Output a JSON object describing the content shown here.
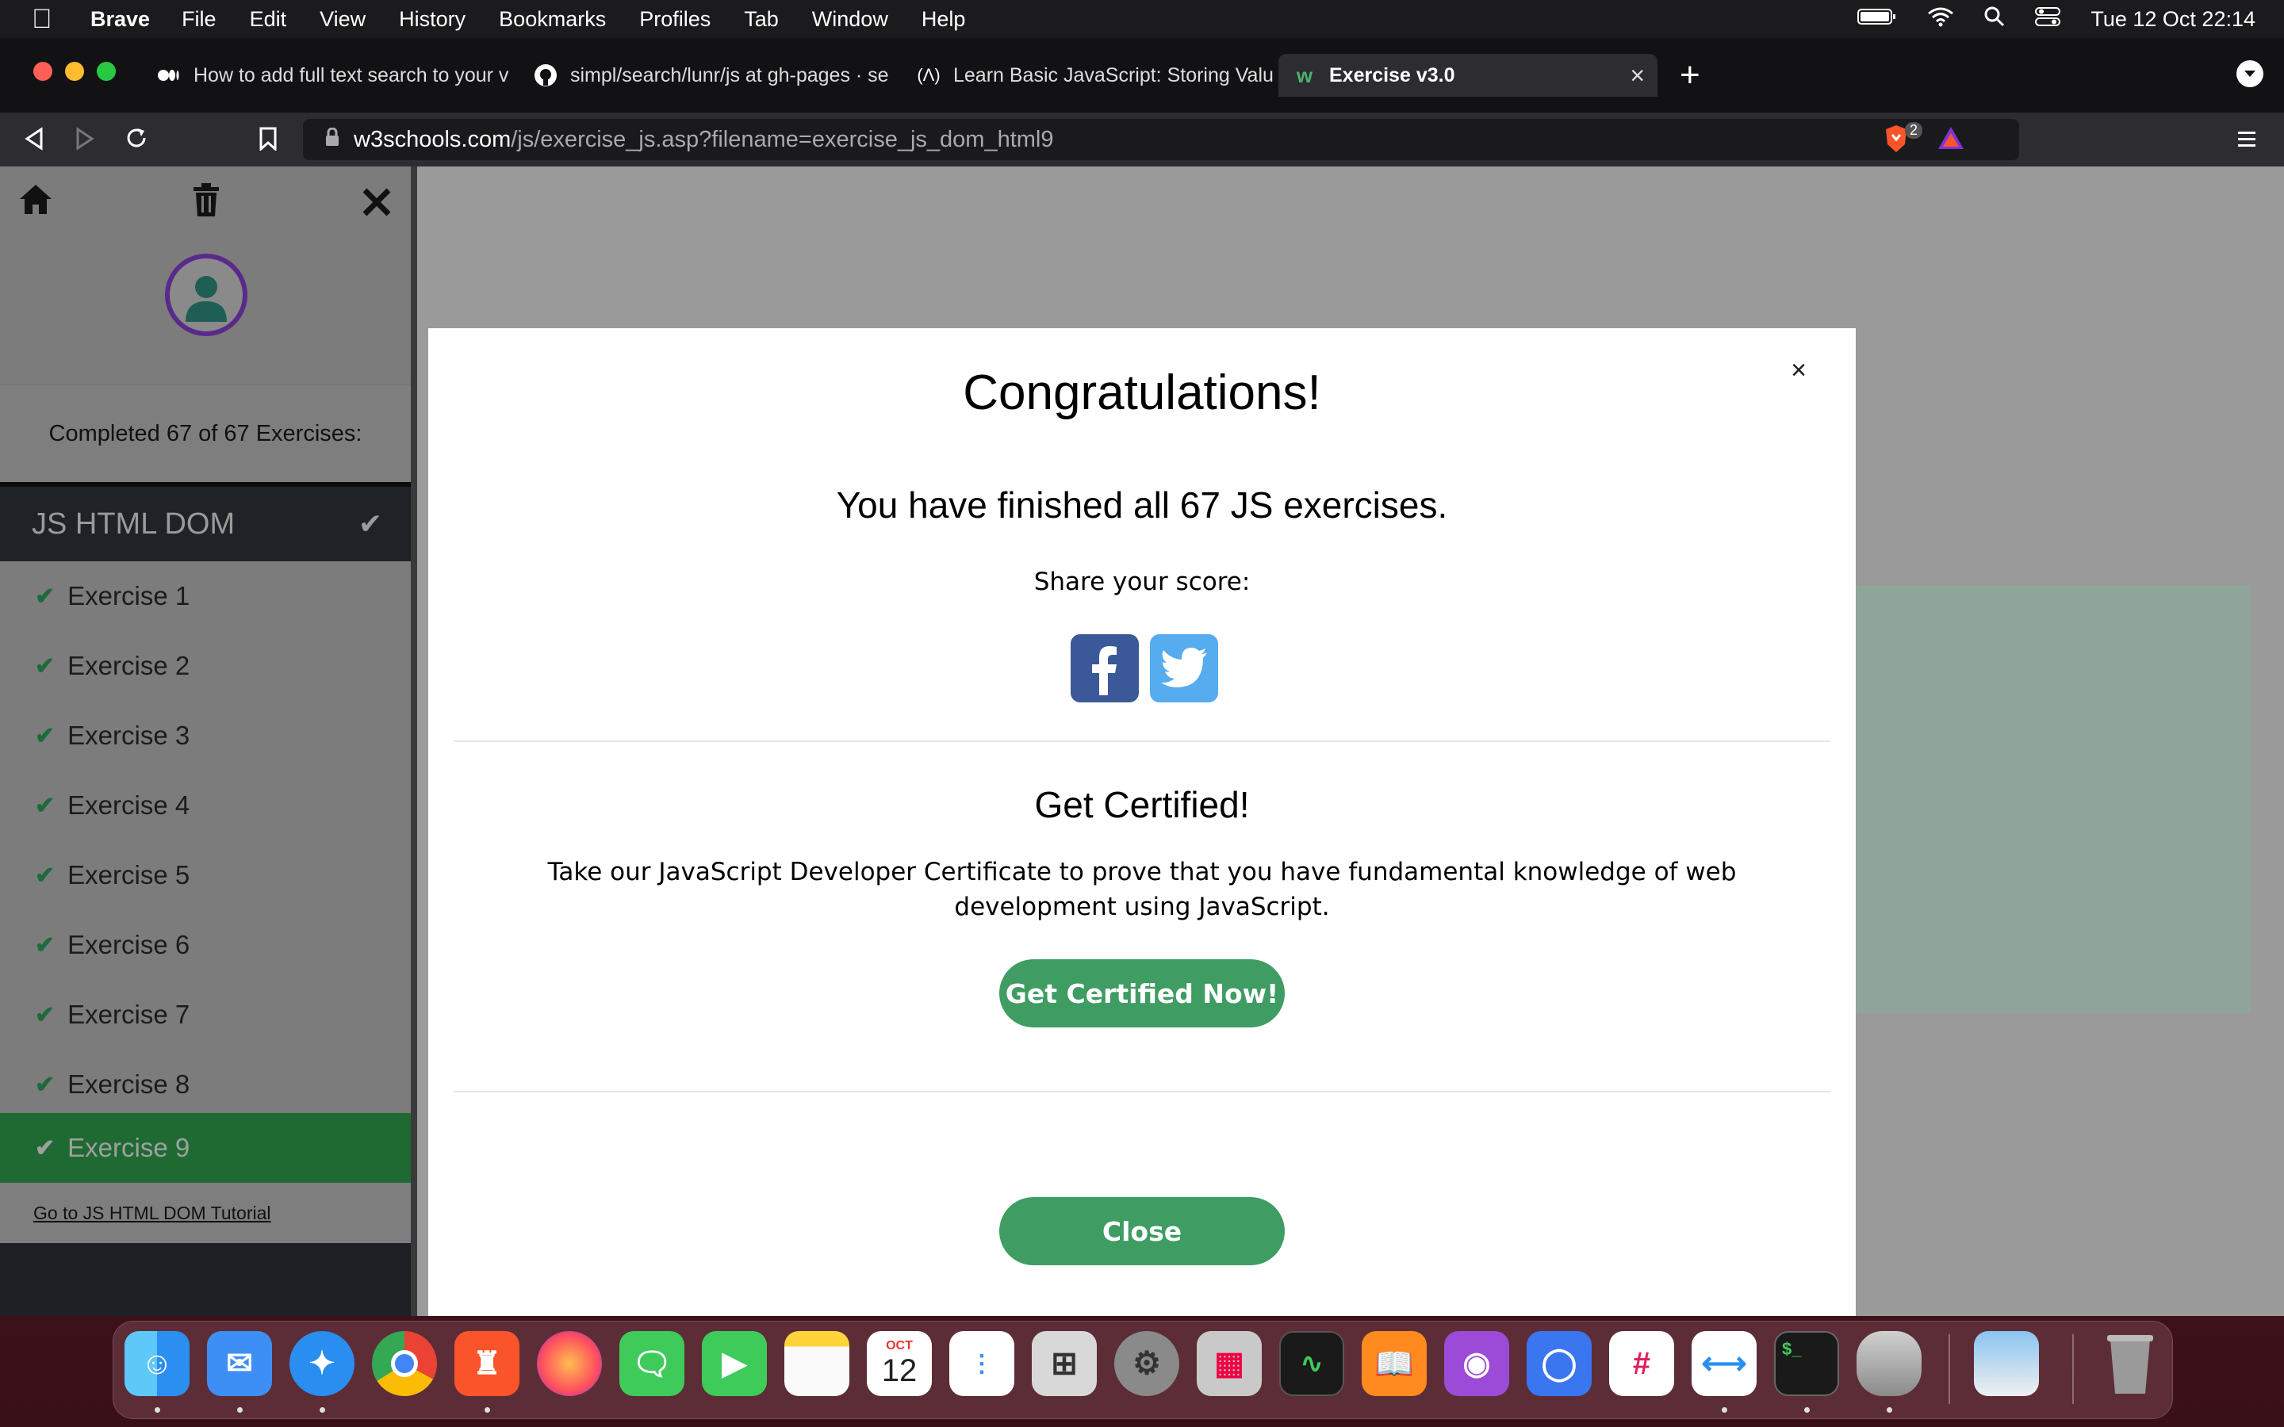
{
  "menubar": {
    "app_name": "Brave",
    "items": [
      "File",
      "Edit",
      "View",
      "History",
      "Bookmarks",
      "Profiles",
      "Tab",
      "Window",
      "Help"
    ],
    "clock": "Tue 12 Oct  22:14"
  },
  "tabs": [
    {
      "title": "How to add full text search to your v",
      "icon": "medium-icon"
    },
    {
      "title": "simpl/search/lunr/js at gh-pages · se",
      "icon": "github-icon"
    },
    {
      "title": "Learn Basic JavaScript: Storing Valu",
      "icon": "freecodecamp-icon"
    },
    {
      "title": "Exercise v3.0",
      "icon": "w3schools-icon",
      "active": true
    }
  ],
  "url": {
    "host": "w3schools.com",
    "path": "/js/exercise_js.asp?filename=exercise_js_dom_html9"
  },
  "brave_badge": "2",
  "sidebar": {
    "completed": "Completed 67 of 67 Exercises:",
    "section": "JS HTML DOM",
    "exercises": [
      "Exercise 1",
      "Exercise 2",
      "Exercise 3",
      "Exercise 4",
      "Exercise 5",
      "Exercise 6",
      "Exercise 7",
      "Exercise 8",
      "Exercise 9"
    ],
    "active_exercise": "Exercise 9",
    "tutorial_link": "Go to JS HTML DOM Tutorial"
  },
  "modal": {
    "close_symbol": "×",
    "title": "Congratulations!",
    "finished": "You have finished all 67 JS exercises.",
    "share": "Share your score:",
    "cert_title": "Get Certified!",
    "cert_text": "Take our JavaScript Developer Certificate to prove that you have fundamental knowledge of web development using JavaScript.",
    "cert_button": "Get Certified Now!",
    "close_button": "Close"
  },
  "dock": {
    "calendar_month": "OCT",
    "calendar_day": "12",
    "apps": [
      "finder",
      "mail",
      "safari",
      "chrome",
      "brave",
      "firefox",
      "messages",
      "facetime",
      "notes",
      "calendar",
      "reminders",
      "calculator",
      "system-preferences",
      "launchpad",
      "activity-monitor",
      "books",
      "podcasts",
      "signal",
      "slack",
      "vscode",
      "terminal",
      "database",
      "preview",
      "trash"
    ]
  },
  "colors": {
    "accent_green": "#3f9c62",
    "active_exercise_bg": "#1f6a33",
    "avatar_ring": "#5a2a8a"
  }
}
